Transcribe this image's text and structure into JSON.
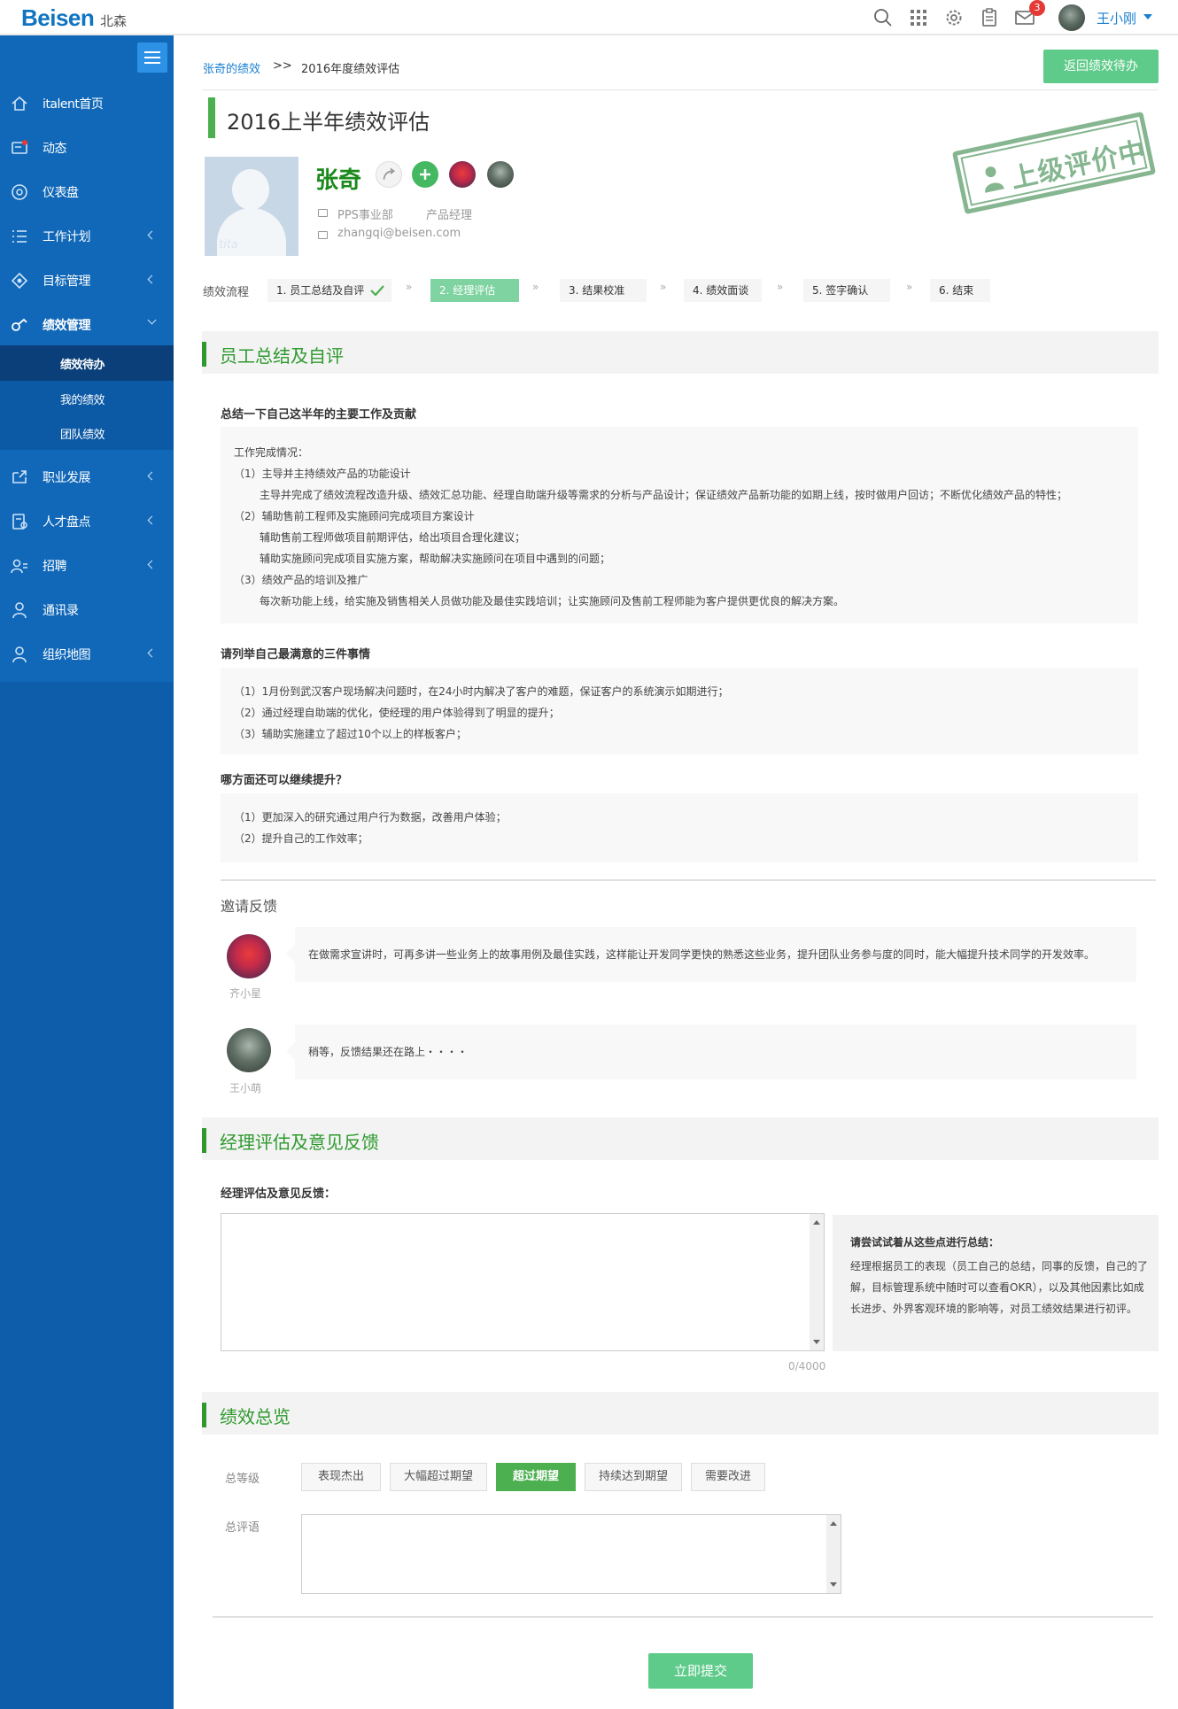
{
  "header": {
    "logo": "Beisen",
    "logo_sub": "北森",
    "notification_count": "3",
    "user_name": "王小刚",
    "icons": [
      "search-icon",
      "apps-grid-icon",
      "settings-icon",
      "clipboard-icon",
      "mail-icon"
    ]
  },
  "sidebar": {
    "items": [
      {
        "label": "italent首页",
        "icon": "home-icon"
      },
      {
        "label": "动态",
        "icon": "feed-icon"
      },
      {
        "label": "仪表盘",
        "icon": "dashboard-icon"
      },
      {
        "label": "工作计划",
        "icon": "list-icon"
      },
      {
        "label": "目标管理",
        "icon": "target-icon"
      },
      {
        "label": "绩效管理",
        "icon": "performance-icon"
      },
      {
        "label": "职业发展",
        "icon": "career-icon"
      },
      {
        "label": "人才盘点",
        "icon": "talent-icon"
      },
      {
        "label": "招聘",
        "icon": "recruit-icon"
      },
      {
        "label": "通讯录",
        "icon": "contacts-icon"
      },
      {
        "label": "组织地图",
        "icon": "org-map-icon"
      }
    ],
    "sub_items": [
      "绩效待办",
      "我的绩效",
      "团队绩效"
    ]
  },
  "breadcrumb": {
    "root": "张奇的绩效",
    "sep": ">>",
    "current": "2016年度绩效评估"
  },
  "back_button": "返回绩效待办",
  "page_title": "2016上半年绩效评估",
  "profile": {
    "name": "张奇",
    "department": "PPS事业部",
    "position": "产品经理",
    "email": "zhangqi@beisen.com",
    "avatar_watermark": "tita"
  },
  "stamp_text": "上级评价中",
  "steps": {
    "label": "绩效流程",
    "items": [
      "1. 员工总结及自评",
      "2. 经理评估",
      "3. 结果校准",
      "4. 绩效面谈",
      "5. 签字确认",
      "6. 结束"
    ],
    "sep": "»"
  },
  "section1": {
    "title": "员工总结及自评",
    "q1": "总结一下自己这半年的主要工作及贡献",
    "a1": [
      "工作完成情况：",
      "（1）主导并主持绩效产品的功能设计",
      "主导并完成了绩效流程改造升级、绩效汇总功能、经理自助端升级等需求的分析与产品设计；保证绩效产品新功能的如期上线，按时做用户回访；不断优化绩效产品的特性；",
      "（2）辅助售前工程师及实施顾问完成项目方案设计",
      "辅助售前工程师做项目前期评估，给出项目合理化建议；",
      "辅助实施顾问完成项目实施方案，帮助解决实施顾问在项目中遇到的问题；",
      "（3）绩效产品的培训及推广",
      "每次新功能上线，给实施及销售相关人员做功能及最佳实践培训；让实施顾问及售前工程师能为客户提供更优良的解决方案。"
    ],
    "q2": "请列举自己最满意的三件事情",
    "a2": [
      "（1）1月份到武汉客户现场解决问题时，在24小时内解决了客户的难题，保证客户的系统演示如期进行；",
      "（2）通过经理自助端的优化，使经理的用户体验得到了明显的提升；",
      "（3）辅助实施建立了超过10个以上的样板客户；"
    ],
    "q3": "哪方面还可以继续提升？",
    "a3": [
      "（1）更加深入的研究通过用户行为数据，改善用户体验；",
      "（2）提升自己的工作效率；"
    ]
  },
  "feedback": {
    "title": "邀请反馈",
    "items": [
      {
        "name": "齐小星",
        "text": "在做需求宣讲时，可再多讲一些业务上的故事用例及最佳实践，这样能让开发同学更快的熟悉这些业务，提升团队业务参与度的同时，能大幅提升技术同学的开发效率。"
      },
      {
        "name": "王小萌",
        "text": "稍等，反馈结果还在路上・・・・"
      }
    ]
  },
  "section2": {
    "title": "经理评估及意见反馈",
    "label": "经理评估及意见反馈：",
    "textarea_value": "",
    "counter": "0/4000",
    "tip_title": "请尝试试着从这些点进行总结：",
    "tip_body": "经理根据员工的表现（员工自己的总结，同事的反馈，自己的了解，目标管理系统中随时可以查看OKR），以及其他因素比如成长进步、外界客观环境的影响等，对员工绩效结果进行初评。"
  },
  "section3": {
    "title": "绩效总览",
    "level_label": "总等级",
    "levels": [
      "表现杰出",
      "大幅超过期望",
      "超过期望",
      "持续达到期望",
      "需要改进"
    ],
    "selected_level": "超过期望",
    "comment_label": "总评语",
    "comment_value": ""
  },
  "submit_label": "立即提交",
  "colors": {
    "sidebar": "#0d5dab",
    "accent_green": "#4caf50",
    "button_green": "#5ecb8a",
    "link_blue": "#1a7fd1"
  }
}
